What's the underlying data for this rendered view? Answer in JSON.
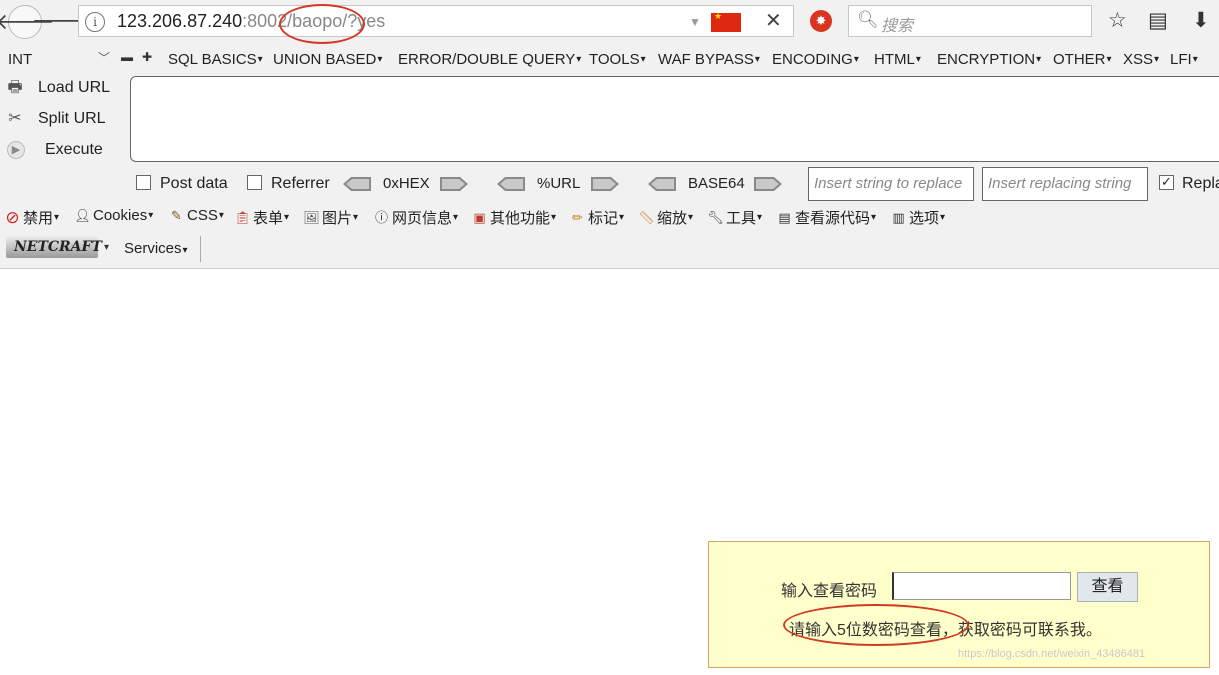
{
  "browser": {
    "url_host": "123.206.87.240",
    "url_port": ":8002",
    "url_path": "/baopo/",
    "url_query": "?yes",
    "search_placeholder": "搜索"
  },
  "hackbar": {
    "int_select": "INT",
    "menus": [
      "SQL BASICS",
      "UNION BASED",
      "ERROR/DOUBLE QUERY",
      "TOOLS",
      "WAF BYPASS",
      "ENCODING",
      "HTML",
      "ENCRYPTION",
      "OTHER",
      "XSS",
      "LFI"
    ],
    "load_url": "Load URL",
    "split_url": "Split URL",
    "execute": "Execute",
    "post_data": "Post data",
    "referrer": "Referrer",
    "hex": "0xHEX",
    "url_enc": "%URL",
    "base64": "BASE64",
    "insert_replace_placeholder": "Insert string to replace",
    "insert_replacing_placeholder": "Insert replacing string",
    "replace_all": "Replace All"
  },
  "webdev": {
    "items": [
      "禁用",
      "Cookies",
      "CSS",
      "表单",
      "图片",
      "网页信息",
      "其他功能",
      "标记",
      "缩放",
      "工具",
      "查看源代码",
      "选项"
    ]
  },
  "netcraft": {
    "logo": "NETCRAFT",
    "services": "Services"
  },
  "page": {
    "prompt": "输入查看密码",
    "button": "查看",
    "hint": "请输入5位数密码查看，获取密码可联系我。",
    "watermark": "https://blog.csdn.net/weixin_43486481"
  },
  "colors": {
    "annotation": "#d23a24",
    "box_bg": "#ffffcc",
    "box_border": "#d6a36a"
  }
}
